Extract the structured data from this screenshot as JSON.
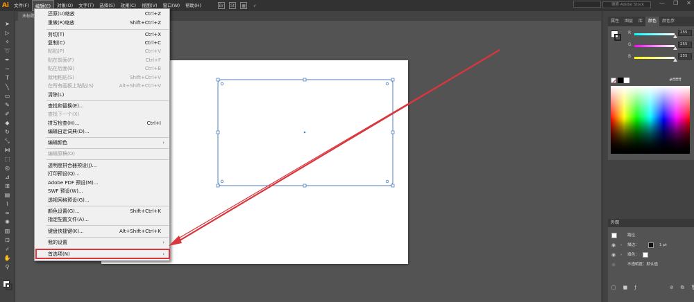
{
  "app": {
    "logo": "Ai",
    "doc_tab": "未标题-"
  },
  "menubar": {
    "items": [
      "文件(F)",
      "编辑(E)",
      "对象(O)",
      "文字(T)",
      "选择(S)",
      "效果(C)",
      "视图(V)",
      "窗口(W)",
      "帮助(H)"
    ],
    "bridge_icon": "Br",
    "stock_icon": "St",
    "stock_search_placeholder": "搜索 Adobe Stock",
    "window_controls": [
      "—",
      "❐",
      "✕"
    ]
  },
  "edit_menu": {
    "items": [
      {
        "label": "还原(U)缩放",
        "shortcut": "Ctrl+Z",
        "disabled": false
      },
      {
        "label": "重做(R)缩放",
        "shortcut": "Shift+Ctrl+Z",
        "disabled": false
      },
      {
        "label": "剪切(T)",
        "shortcut": "Ctrl+X",
        "disabled": false
      },
      {
        "label": "复制(C)",
        "shortcut": "Ctrl+C",
        "disabled": false
      },
      {
        "label": "粘贴(P)",
        "shortcut": "Ctrl+V",
        "disabled": true
      },
      {
        "label": "贴在前面(F)",
        "shortcut": "Ctrl+F",
        "disabled": true
      },
      {
        "label": "贴在后面(B)",
        "shortcut": "Ctrl+B",
        "disabled": true
      },
      {
        "label": "就地粘贴(S)",
        "shortcut": "Shift+Ctrl+V",
        "disabled": true
      },
      {
        "label": "在所有画板上粘贴(S)",
        "shortcut": "Alt+Shift+Ctrl+V",
        "disabled": true
      },
      {
        "label": "清除(L)",
        "shortcut": "",
        "disabled": false
      },
      {
        "label": "查找和替换(E)...",
        "shortcut": "",
        "disabled": false
      },
      {
        "label": "查找下一个(X)",
        "shortcut": "",
        "disabled": true
      },
      {
        "label": "拼写检查(H)...",
        "shortcut": "Ctrl+I",
        "disabled": false
      },
      {
        "label": "编辑自定词典(D)...",
        "shortcut": "",
        "disabled": false
      },
      {
        "label": "编辑颜色",
        "shortcut": "",
        "disabled": false,
        "submenu": true
      },
      {
        "label": "编辑原稿(O)",
        "shortcut": "",
        "disabled": true
      },
      {
        "label": "透明度拼合器预设(J)...",
        "shortcut": "",
        "disabled": false
      },
      {
        "label": "打印预设(Q)...",
        "shortcut": "",
        "disabled": false
      },
      {
        "label": "Adobe PDF 预设(M)...",
        "shortcut": "",
        "disabled": false
      },
      {
        "label": "SWF 预设(W)...",
        "shortcut": "",
        "disabled": false
      },
      {
        "label": "透视网格预设(G)...",
        "shortcut": "",
        "disabled": false
      },
      {
        "label": "颜色设置(G)...",
        "shortcut": "Shift+Ctrl+K",
        "disabled": false
      },
      {
        "label": "指定配置文件(A)...",
        "shortcut": "",
        "disabled": false
      },
      {
        "label": "键盘快捷键(K)...",
        "shortcut": "Alt+Shift+Ctrl+K",
        "disabled": false
      },
      {
        "label": "我的设置",
        "shortcut": "",
        "disabled": false,
        "submenu": true
      },
      {
        "label": "首选项(N)",
        "shortcut": "",
        "disabled": false,
        "submenu": true,
        "highlighted": true
      }
    ],
    "submenu_arrow": "›"
  },
  "right_panel": {
    "tabs": [
      "属性",
      "图层",
      "库",
      "颜色",
      "颜色参"
    ],
    "active_tab": "颜色",
    "sliders": [
      {
        "label": "R",
        "value": "255",
        "color": "#ff0000"
      },
      {
        "label": "G",
        "value": "255",
        "color": "#00ff00"
      },
      {
        "label": "B",
        "value": "255",
        "color": "#0000ff"
      }
    ],
    "hex_prefix": "#",
    "hex_value": "ffffff",
    "appearance": {
      "title": "外观",
      "object_label": "路径",
      "stroke_label": "描边：",
      "stroke_weight": "1 pt",
      "fill_label": "填色：",
      "opacity_label": "不透明度：默认值"
    }
  },
  "colors": {
    "annotation": "#d9363e",
    "selection": "#4f7fbf",
    "menubar_bg": "#323232",
    "canvas_bg": "#535353"
  }
}
